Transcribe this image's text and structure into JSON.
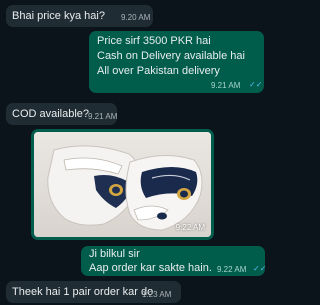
{
  "messages": [
    {
      "type": "incoming",
      "text": "Bhai price kya hai?",
      "time": "9.20 AM"
    },
    {
      "type": "outgoing",
      "lines": [
        "Price sirf 3500 PKR hai",
        "Cash on Delivery available hai",
        "All over Pakistan delivery"
      ],
      "time": "9.21 AM"
    },
    {
      "type": "incoming",
      "text": "COD available?",
      "time": "9.21 AM"
    },
    {
      "type": "image",
      "time": "9:22 AM",
      "alt": "white sandals photo"
    },
    {
      "type": "outgoing",
      "lines": [
        "Ji bilkul sir",
        "Aap order kar sakte hain."
      ],
      "time": "9.22 AM"
    },
    {
      "type": "incoming",
      "text": "Theek hai 1 pair order kar do",
      "time": "1:23 AM"
    }
  ],
  "colors": {
    "background": "#0b141a",
    "incoming_bubble": "#202c33",
    "outgoing_bubble": "#005c4b",
    "read_ticks": "#53bdeb"
  },
  "icons": [
    "double-check-icon"
  ]
}
